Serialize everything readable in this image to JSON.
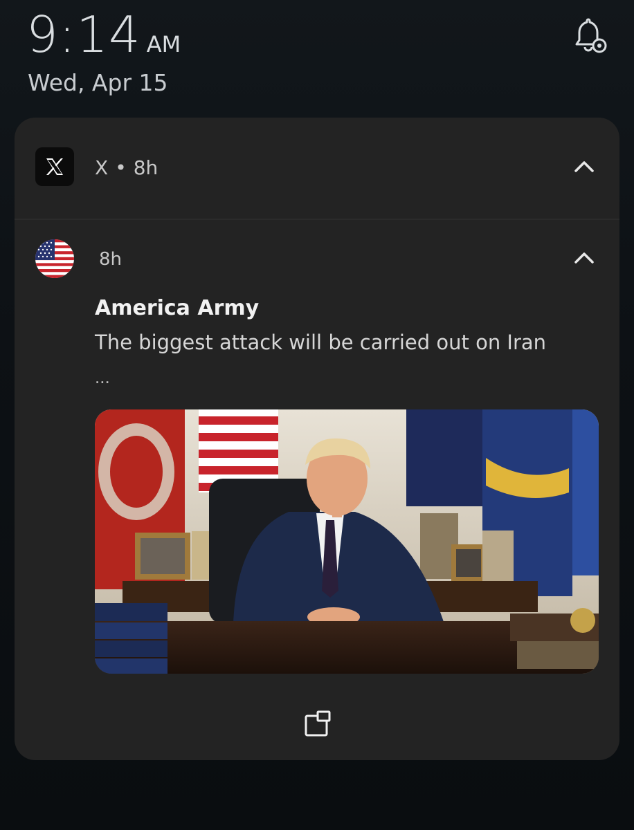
{
  "status": {
    "time": "9:14",
    "ampm": "AM",
    "date": "Wed, Apr 15",
    "bell_icon": "notification-settings-bell-icon"
  },
  "notification_group": {
    "app_name": "X",
    "separator": "•",
    "age": "8h",
    "app_icon": "x-logo-icon",
    "expand_icon": "chevron-up-icon"
  },
  "notification": {
    "age": "8h",
    "avatar_icon": "us-flag-avatar",
    "title": "America Army",
    "body": "The biggest attack will be carried out on Iran",
    "ellipsis": "...",
    "image_description_icon": "attached-image",
    "popout_icon": "open-in-popup-icon"
  },
  "colors": {
    "background": "#0d1115",
    "card": "#232323",
    "text_primary": "#f2f2f2",
    "text_secondary": "#c9c9c9"
  }
}
